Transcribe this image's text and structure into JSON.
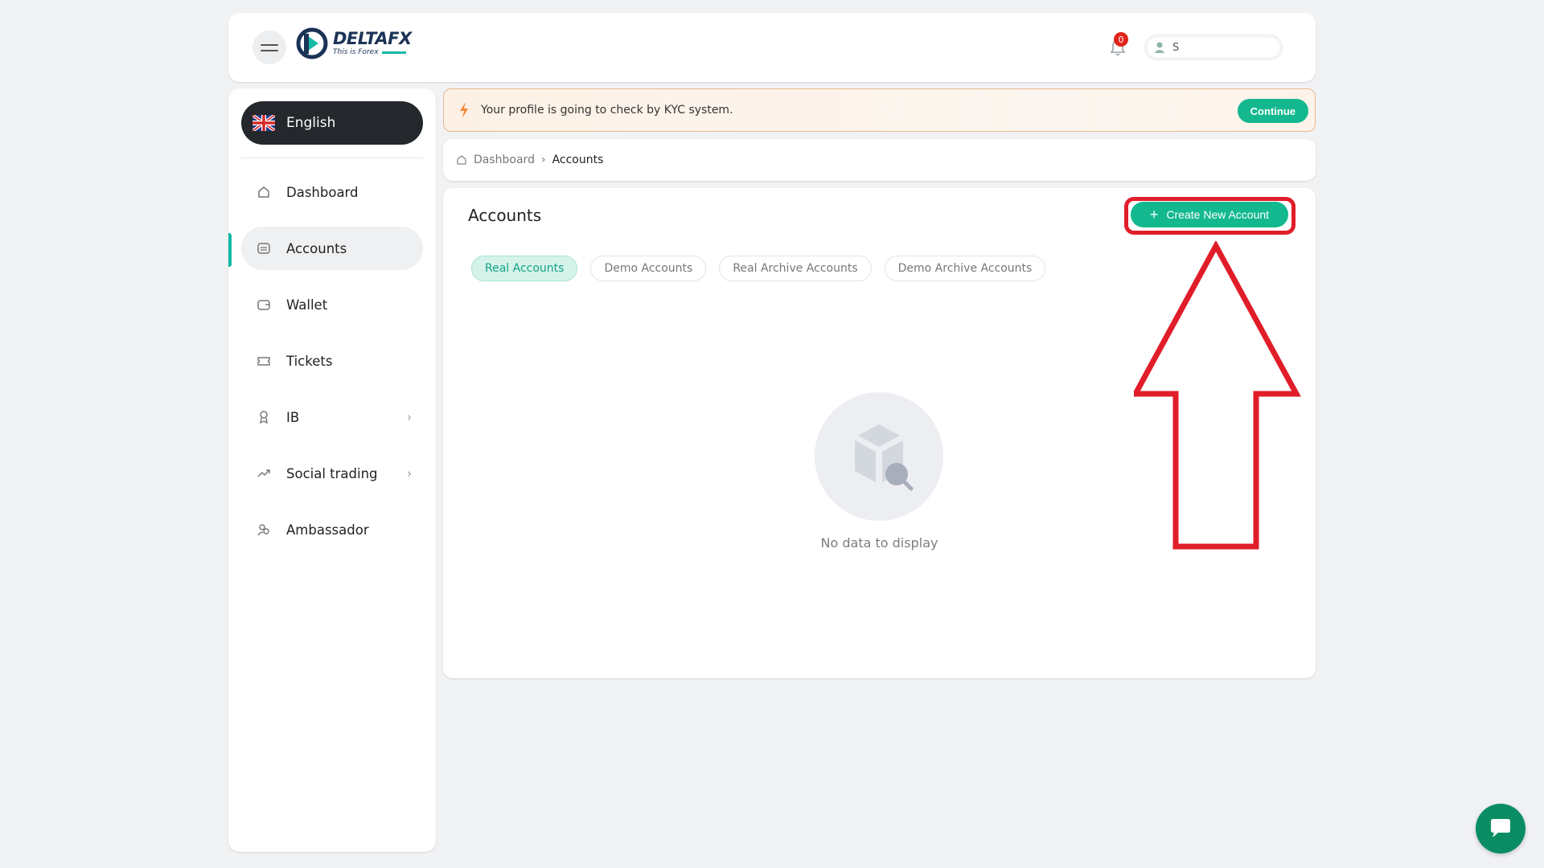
{
  "header": {
    "brand": "DELTAFX",
    "tagline": "This is Forex",
    "notification_count": "0",
    "user_initial": "S"
  },
  "sidebar": {
    "language": "English",
    "items": [
      {
        "label": "Dashboard",
        "icon": "home-icon"
      },
      {
        "label": "Accounts",
        "icon": "accounts-icon",
        "active": true
      },
      {
        "label": "Wallet",
        "icon": "wallet-icon"
      },
      {
        "label": "Tickets",
        "icon": "ticket-icon"
      },
      {
        "label": "IB",
        "icon": "badge-icon",
        "has_submenu": true
      },
      {
        "label": "Social trading",
        "icon": "trending-icon",
        "has_submenu": true
      },
      {
        "label": "Ambassador",
        "icon": "users-icon"
      }
    ]
  },
  "kyc": {
    "message": "Your profile is going to check by KYC system.",
    "button": "Continue"
  },
  "breadcrumb": {
    "home": "Dashboard",
    "separator": "›",
    "current": "Accounts"
  },
  "main": {
    "title": "Accounts",
    "create_button": "Create New Account",
    "tabs": [
      "Real Accounts",
      "Demo Accounts",
      "Real Archive Accounts",
      "Demo Archive Accounts"
    ],
    "active_tab": "Real Accounts",
    "empty_text": "No data to display"
  },
  "colors": {
    "accent": "#14b88f",
    "annotation": "#e11d2a",
    "badge": "#e0241b"
  }
}
